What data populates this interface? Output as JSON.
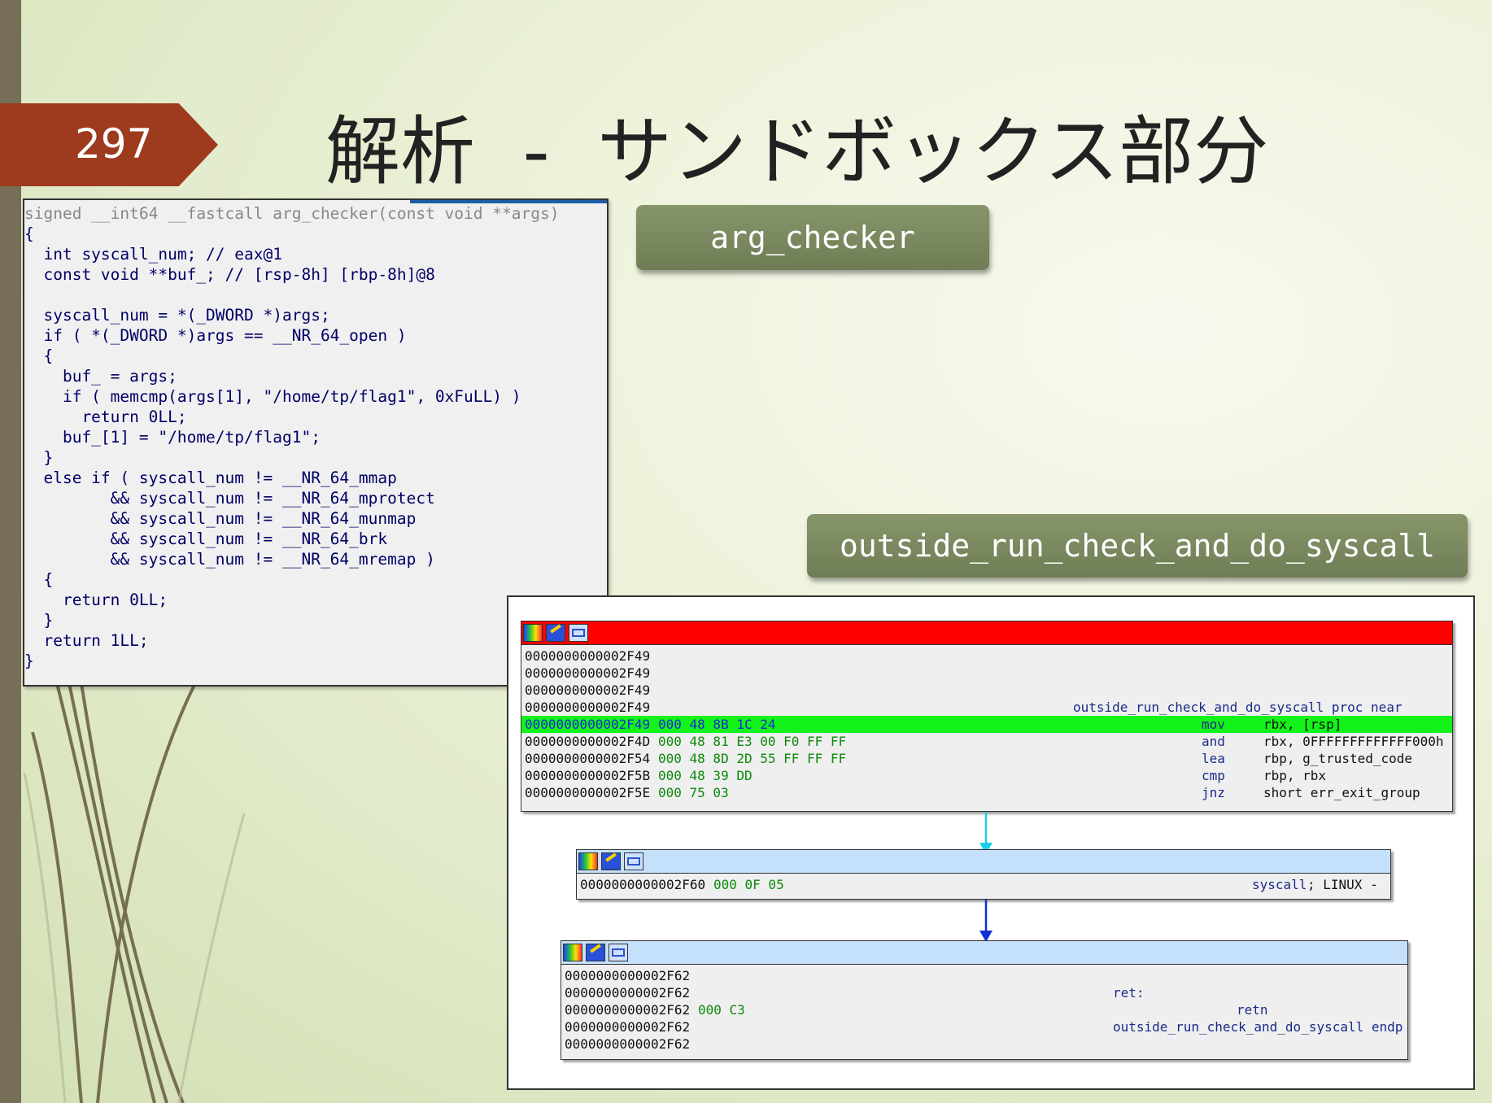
{
  "slide": {
    "page_number": "297",
    "title": "解析  -  サンドボックス部分"
  },
  "labels": {
    "arg_checker": "arg_checker",
    "outside": "outside_run_check_and_do_syscall"
  },
  "code": {
    "lines": [
      "signed __int64 __fastcall arg_checker(const void **args)",
      "{",
      "  int syscall_num; // eax@1",
      "  const void **buf_; // [rsp-8h] [rbp-8h]@8",
      "",
      "  syscall_num = *(_DWORD *)args;",
      "  if ( *(_DWORD *)args == __NR_64_open )",
      "  {",
      "    buf_ = args;",
      "    if ( memcmp(args[1], \"/home/tp/flag1\", 0xFuLL) )",
      "      return 0LL;",
      "    buf_[1] = \"/home/tp/flag1\";",
      "  }",
      "  else if ( syscall_num != __NR_64_mmap",
      "         && syscall_num != __NR_64_mprotect",
      "         && syscall_num != __NR_64_munmap",
      "         && syscall_num != __NR_64_brk",
      "         && syscall_num != __NR_64_mremap )",
      "  {",
      "    return 0LL;",
      "  }",
      "  return 1LL;",
      "}"
    ]
  },
  "graph": {
    "node1": {
      "header_color": "#ff0000",
      "rows": [
        {
          "addr": "0000000000002F49",
          "bytes": "",
          "mn": "",
          "op": "",
          "label": ""
        },
        {
          "addr": "0000000000002F49",
          "bytes": "",
          "mn": "",
          "op": "",
          "label": ""
        },
        {
          "addr": "0000000000002F49",
          "bytes": "",
          "mn": "",
          "op": "",
          "label": ""
        },
        {
          "addr": "0000000000002F49",
          "bytes": "",
          "mn": "",
          "op": "",
          "label": "outside_run_check_and_do_syscall proc near"
        },
        {
          "addr": "0000000000002F49",
          "bytes": "000 48 8B 1C 24",
          "mn": "mov",
          "op": "rbx, [rsp]",
          "label": ""
        },
        {
          "addr": "0000000000002F4D",
          "bytes": "000 48 81 E3 00 F0 FF FF",
          "mn": "and",
          "op": "rbx, 0FFFFFFFFFFFFF000h",
          "label": ""
        },
        {
          "addr": "0000000000002F54",
          "bytes": "000 48 8D 2D 55 FF FF FF",
          "mn": "lea",
          "op": "rbp, g_trusted_code",
          "label": ""
        },
        {
          "addr": "0000000000002F5B",
          "bytes": "000 48 39 DD",
          "mn": "cmp",
          "op": "rbp, rbx",
          "label": ""
        },
        {
          "addr": "0000000000002F5E",
          "bytes": "000 75 03",
          "mn": "jnz",
          "op": "short err_exit_group",
          "label": ""
        }
      ]
    },
    "node2": {
      "header_color": "#c4e0fa",
      "rows": [
        {
          "addr": "0000000000002F60",
          "bytes": "000 0F 05",
          "mn": "syscall",
          "op": "; LINUX -"
        }
      ]
    },
    "node3": {
      "header_color": "#c4e0fa",
      "rows": [
        {
          "addr": "0000000000002F62",
          "bytes": "",
          "mn": "",
          "label": ""
        },
        {
          "addr": "0000000000002F62",
          "bytes": "",
          "mn": "",
          "label": "ret:"
        },
        {
          "addr": "0000000000002F62",
          "bytes": "000 C3",
          "mn": "retn",
          "label": ""
        },
        {
          "addr": "0000000000002F62",
          "bytes": "",
          "mn": "",
          "label": "outside_run_check_and_do_syscall endp"
        },
        {
          "addr": "0000000000002F62",
          "bytes": "",
          "mn": "",
          "label": ""
        }
      ]
    }
  },
  "colors": {
    "badge": "#9e3b1f",
    "pill": "#7a8a5e",
    "highlight_row": "#13f31a",
    "arrow_cyan": "#18d0e8",
    "arrow_blue": "#1030d0"
  }
}
